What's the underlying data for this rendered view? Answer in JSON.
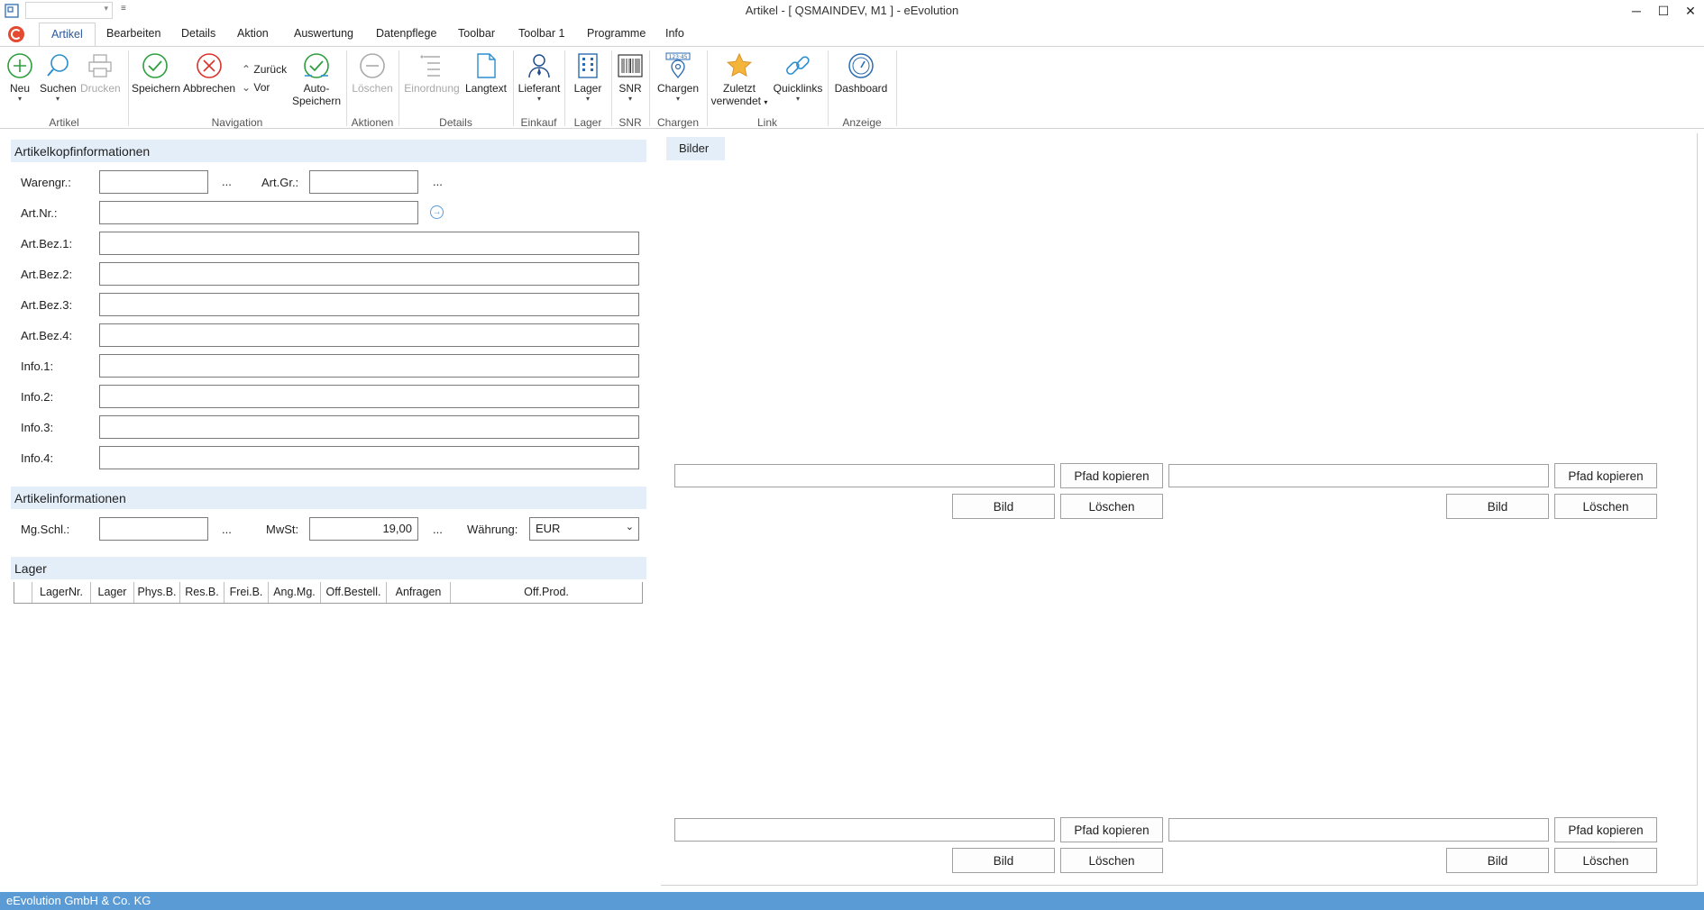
{
  "window": {
    "title": "Artikel - [ QSMAINDEV, M1 ]  -  eEvolution",
    "minimize": "─",
    "maximize": "☐",
    "close": "✕"
  },
  "quick_access": {
    "dropdown_arrow": "▾",
    "customize": "≡"
  },
  "ribbon_tabs": [
    "Artikel",
    "Bearbeiten",
    "Details",
    "Aktion",
    "Auswertung",
    "Datenpflege",
    "Toolbar",
    "Toolbar 1",
    "Programme",
    "Info"
  ],
  "ribbon": {
    "neu": "Neu",
    "suchen": "Suchen",
    "drucken": "Drucken",
    "speichern": "Speichern",
    "abbrechen": "Abbrechen",
    "zurueck": "Zurück",
    "vor": "Vor",
    "auto_speichern_1": "Auto-",
    "auto_speichern_2": "Speichern",
    "loeschen": "Löschen",
    "einordnung": "Einordnung",
    "langtext": "Langtext",
    "lieferant": "Lieferant",
    "lager": "Lager",
    "snr": "SNR",
    "chargen": "Chargen",
    "zuletzt_1": "Zuletzt",
    "zuletzt_2": "verwendet",
    "quicklinks": "Quicklinks",
    "dashboard": "Dashboard",
    "chargen_badge": "123·45",
    "dropdown": "▾",
    "groups": {
      "artikel": "Artikel",
      "navigation": "Navigation",
      "aktionen": "Aktionen",
      "details": "Details",
      "einkauf": "Einkauf",
      "lager": "Lager",
      "snr": "SNR",
      "chargen": "Chargen",
      "link": "Link",
      "anzeige": "Anzeige"
    }
  },
  "kopf": {
    "header": "Artikelkopfinformationen",
    "warengr": "Warengr.:",
    "artgr": "Art.Gr.:",
    "dots": "...",
    "artnr": "Art.Nr.:",
    "go": "→",
    "artbez1": "Art.Bez.1:",
    "artbez2": "Art.Bez.2:",
    "artbez3": "Art.Bez.3:",
    "artbez4": "Art.Bez.4:",
    "info1": "Info.1:",
    "info2": "Info.2:",
    "info3": "Info.3:",
    "info4": "Info.4:"
  },
  "artinfo": {
    "header": "Artikelinformationen",
    "mgschl": "Mg.Schl.:",
    "mwst": "MwSt:",
    "mwst_value": "19,00",
    "waehrung": "Währung:",
    "waehrung_value": "EUR",
    "dots": "..."
  },
  "lager": {
    "header": "Lager",
    "columns": [
      "",
      "LagerNr.",
      "Lager",
      "Phys.B.",
      "Res.B.",
      "Frei.B.",
      "Ang.Mg.",
      "Off.Bestell.",
      "Anfragen",
      "Off.Prod."
    ]
  },
  "bilder": {
    "tab": "Bilder",
    "pfad_kopieren": "Pfad kopieren",
    "bild": "Bild",
    "loeschen": "Löschen"
  },
  "status": {
    "text": "eEvolution GmbH & Co. KG"
  }
}
